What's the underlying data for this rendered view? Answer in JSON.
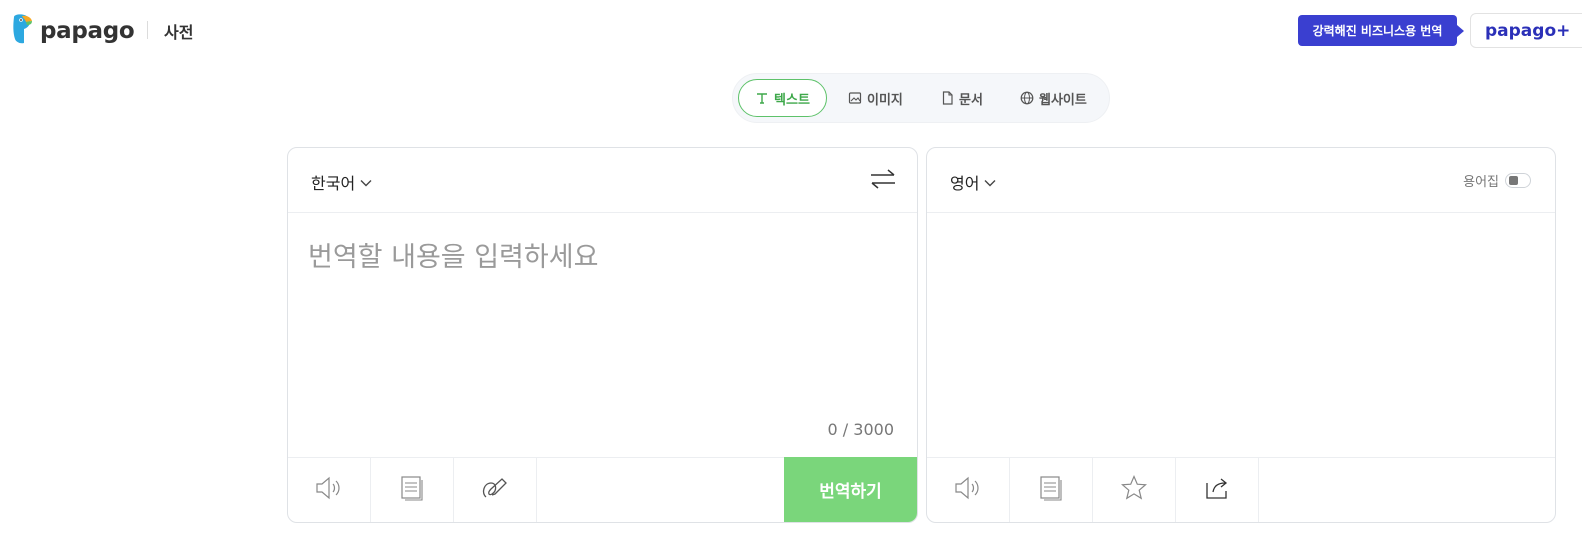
{
  "header": {
    "logo_text": "papago",
    "dictionary_link": "사전",
    "business_badge": "강력해진 비즈니스용 번역",
    "papago_plus": "papago+"
  },
  "mode_tabs": [
    {
      "label": "텍스트",
      "icon": "text-icon",
      "active": true
    },
    {
      "label": "이미지",
      "icon": "image-icon",
      "active": false
    },
    {
      "label": "문서",
      "icon": "document-icon",
      "active": false
    },
    {
      "label": "웹사이트",
      "icon": "globe-icon",
      "active": false
    }
  ],
  "source": {
    "language": "한국어",
    "placeholder": "번역할 내용을 입력하세요",
    "value": "",
    "char_count": "0 / 3000",
    "toolbar_icons": [
      "speaker-icon",
      "copy-icon",
      "handwriting-icon"
    ],
    "translate_button": "번역하기"
  },
  "target": {
    "language": "영어",
    "glossary_label": "용어집",
    "glossary_enabled": false,
    "toolbar_icons": [
      "speaker-icon",
      "copy-icon",
      "star-icon",
      "share-icon"
    ]
  },
  "colors": {
    "accent_green": "#7ad67b",
    "active_tab_green": "#3ea84a",
    "business_blue": "#3a3fd0",
    "plus_blue": "#2b30b8"
  }
}
